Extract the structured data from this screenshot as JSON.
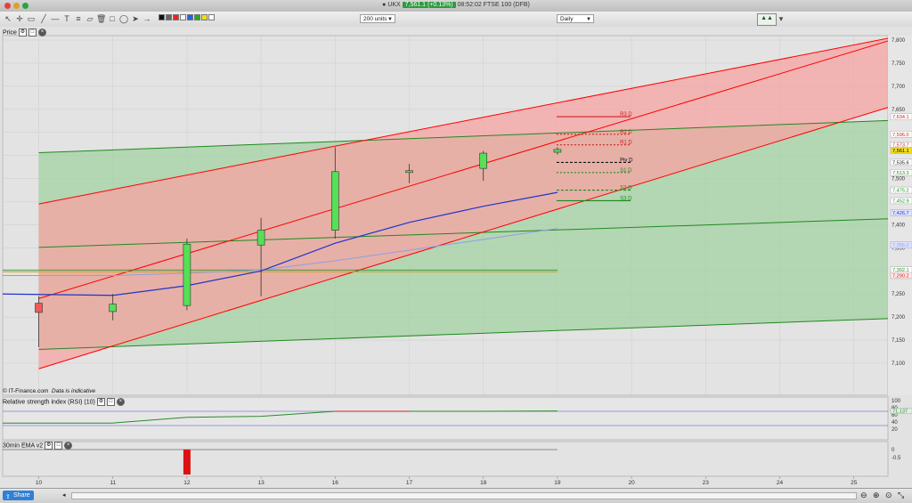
{
  "window": {
    "title_prefix": "UKX",
    "price_badge": "7,561.1 (+0.13%)",
    "title_suffix": "08:52:02 FTSE 100 (DFB)"
  },
  "toolbar": {
    "units_select": "200 units",
    "interval_select": "Daily"
  },
  "colors": {
    "red_channel": "#ff0000",
    "green_channel": "#1e8a1e",
    "red_fill": "#f7a3a3",
    "green_fill": "#a3d1a3",
    "overlap_fill": "#b8987a",
    "ema_dark": "#2233cc",
    "ema_light": "#8f9fe0",
    "gold_line": "#d4a017",
    "bull_candle": "#55e055",
    "bear_candle": "#ef5a5a",
    "rsi_line": "#2a8a2a",
    "rsi_red": "#d22020"
  },
  "price_panel": {
    "title": "Price",
    "footer_source": "© IT-Finance.com",
    "footer_note": "Data is indicative"
  },
  "rsi_panel": {
    "title": "Relative strength index (RSI) (10)"
  },
  "ema_panel": {
    "title": "30min EMA v2"
  },
  "share_button": "Share",
  "chart_data": [
    {
      "type": "candlestick",
      "title": "Price",
      "categories": [
        "10",
        "11",
        "12",
        "13",
        "16",
        "17",
        "18",
        "19"
      ],
      "x_tick_labels": [
        "10",
        "11",
        "12",
        "13",
        "16",
        "17",
        "18",
        "19",
        "20",
        "23",
        "24",
        "25"
      ],
      "ylim": [
        7050,
        7820
      ],
      "y_ticks": [
        7100,
        7150,
        7200,
        7250,
        7300,
        7350,
        7400,
        7450,
        7500,
        7550,
        7600,
        7650,
        7700,
        7750,
        7800
      ],
      "y_tick_labels": [
        "7,100",
        "7,150",
        "7,200",
        "7,250",
        "",
        "7,350",
        "7,400",
        "",
        "7,500",
        "",
        "",
        "7,650",
        "7,700",
        "7,750",
        "7,800"
      ],
      "candles": [
        {
          "x": "10",
          "open": 7230,
          "high": 7245,
          "low": 7135,
          "close": 7210
        },
        {
          "x": "11",
          "open": 7212,
          "high": 7250,
          "low": 7193,
          "close": 7228
        },
        {
          "x": "12",
          "open": 7225,
          "high": 7370,
          "low": 7215,
          "close": 7358
        },
        {
          "x": "13",
          "open": 7356,
          "high": 7415,
          "low": 7245,
          "close": 7388
        },
        {
          "x": "16",
          "open": 7388,
          "high": 7568,
          "low": 7370,
          "close": 7515
        },
        {
          "x": "17",
          "open": 7513,
          "high": 7532,
          "low": 7490,
          "close": 7517
        },
        {
          "x": "18",
          "open": 7522,
          "high": 7560,
          "low": 7495,
          "close": 7555
        },
        {
          "x": "19",
          "open": 7557,
          "high": 7568,
          "low": 7552,
          "close": 7563
        }
      ],
      "ema_fast": [
        7250,
        7247,
        7268,
        7300,
        7360,
        7405,
        7440,
        7470
      ],
      "ema_slow": [
        7290,
        7290,
        7295,
        7302,
        7322,
        7345,
        7368,
        7392
      ],
      "gold_level": 7302,
      "red_channel": {
        "upper": {
          "start": [
            0,
            7445
          ],
          "end": [
            11.5,
            7805
          ]
        },
        "middle": {
          "start": [
            0,
            7240
          ],
          "end": [
            11.5,
            7800
          ]
        },
        "lower": {
          "start": [
            0,
            7088
          ],
          "end": [
            11.5,
            7656
          ]
        }
      },
      "green_channel": {
        "upper": {
          "start": [
            0,
            7556
          ],
          "end": [
            11.5,
            7626
          ]
        },
        "middle": {
          "start": [
            0,
            7351
          ],
          "end": [
            11.5,
            7413
          ]
        },
        "lower": {
          "start": [
            0,
            7130
          ],
          "end": [
            11.5,
            7197
          ]
        }
      },
      "pivots": [
        {
          "label": "R3 D",
          "value": 7634,
          "style": "solid",
          "color": "#d22020"
        },
        {
          "label": "R2 D",
          "value": 7596,
          "style": "dotted",
          "color": "#d22020"
        },
        {
          "label": "R1 D",
          "value": 7573,
          "style": "dotted",
          "color": "#d22020"
        },
        {
          "label": "Piv D",
          "value": 7535,
          "style": "dashed",
          "color": "#111111"
        },
        {
          "label": "S1 D",
          "value": 7513,
          "style": "dotted",
          "color": "#1e8a1e"
        },
        {
          "label": "S2 D",
          "value": 7475,
          "style": "dashed",
          "color": "#1e8a1e"
        },
        {
          "label": "S3 D",
          "value": 7452,
          "style": "solid",
          "color": "#1e8a1e"
        }
      ],
      "price_tags": [
        {
          "text": "7,634.1",
          "value": 7634,
          "bg": "#ffffff",
          "fg": "#d22020"
        },
        {
          "text": "7,596.0",
          "value": 7596,
          "bg": "#ffffff",
          "fg": "#d22020"
        },
        {
          "text": "7,573.7",
          "value": 7573,
          "bg": "#ffffff",
          "fg": "#d22020"
        },
        {
          "text": "7,561.1",
          "value": 7561,
          "bg": "#f0e020",
          "fg": "#000000"
        },
        {
          "text": "7,535.6",
          "value": 7535,
          "bg": "#ffffff",
          "fg": "#111111"
        },
        {
          "text": "7,513.3",
          "value": 7513,
          "bg": "#ffffff",
          "fg": "#1e8a1e"
        },
        {
          "text": "7,475.2",
          "value": 7475,
          "bg": "#ffffff",
          "fg": "#1e8a1e"
        },
        {
          "text": "7,452.9",
          "value": 7452,
          "bg": "#ffffff",
          "fg": "#1e8a1e"
        },
        {
          "text": "7,426.7",
          "value": 7426,
          "bg": "#dfe3ff",
          "fg": "#2233cc"
        },
        {
          "text": "7,356.0",
          "value": 7356,
          "bg": "#dfe3ff",
          "fg": "#8f9fe0"
        },
        {
          "text": "7,302.1",
          "value": 7302,
          "bg": "#ffffff",
          "fg": "#1e8a1e"
        },
        {
          "text": "7,290.2",
          "value": 7290,
          "bg": "#ffe8e8",
          "fg": "#d22020"
        }
      ]
    },
    {
      "type": "line",
      "title": "Relative strength index (RSI) (10)",
      "ylim": [
        0,
        100
      ],
      "y_tick_labels": [
        "100",
        "80",
        "60",
        "40",
        "20"
      ],
      "levels": [
        70,
        30
      ],
      "values": [
        37,
        37,
        53,
        56,
        70,
        70,
        70,
        71
      ],
      "last_value_tag": "71.137"
    },
    {
      "type": "bar",
      "title": "30min EMA v2",
      "ylim": [
        -1.6,
        0.4
      ],
      "y_tick_labels": [
        "0",
        "-0.5"
      ],
      "bars": [
        {
          "x": "12",
          "value": -1.6
        }
      ]
    }
  ]
}
